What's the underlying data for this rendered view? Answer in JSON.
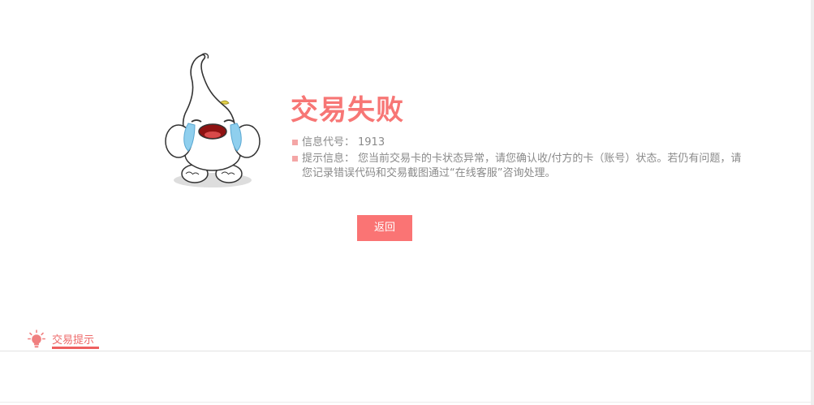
{
  "result": {
    "title": "交易失败",
    "code_label": "信息代号：",
    "code_value": "1913",
    "tip_label": "提示信息：",
    "tip_text": "您当前交易卡的卡状态异常，请您确认收/付方的卡（账号）状态。若仍有问题，请您记录错误代码和交易截图通过“在线客服”咨询处理。"
  },
  "actions": {
    "back_label": "返回"
  },
  "tips_tab": {
    "label": "交易提示"
  },
  "icons": {
    "mascot": "crying-mascot-icon",
    "tips": "lightbulb-icon"
  },
  "colors": {
    "accent": "#f77675",
    "button": "#fa7474",
    "bullet": "#f4a6a6",
    "text": "#8a8a8a"
  }
}
